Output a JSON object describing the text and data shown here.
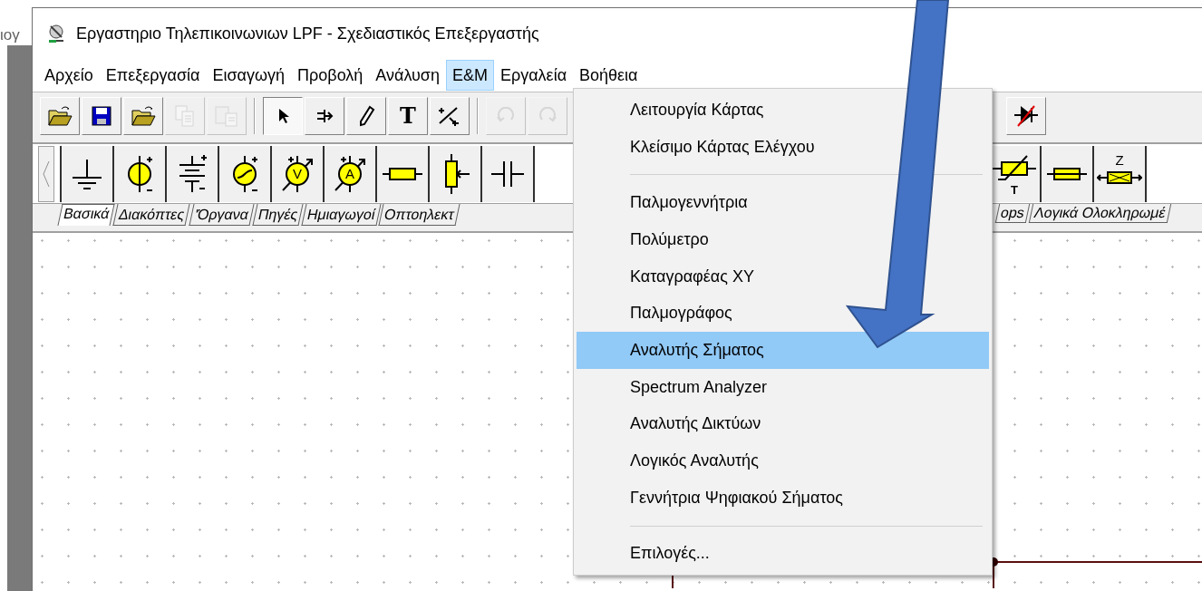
{
  "background_text": "ιογ",
  "window": {
    "title": "Εργαστηριο Τηλεπικοινωνιων LPF - Σχεδιαστικός Επεξεργαστής"
  },
  "menu_bar": [
    {
      "label": "Αρχείο",
      "selected": false
    },
    {
      "label": "Επεξεργασία",
      "selected": false
    },
    {
      "label": "Εισαγωγή",
      "selected": false
    },
    {
      "label": "Προβολή",
      "selected": false
    },
    {
      "label": "Ανάλυση",
      "selected": false
    },
    {
      "label": "E&M",
      "selected": true
    },
    {
      "label": "Εργαλεία",
      "selected": false
    },
    {
      "label": "Βοήθεια",
      "selected": false
    }
  ],
  "toolbar": {
    "left_items": [
      {
        "kind": "open",
        "disabled": false,
        "pressed": false
      },
      {
        "kind": "save",
        "disabled": false,
        "pressed": false
      },
      {
        "kind": "open",
        "disabled": false,
        "pressed": false
      },
      {
        "kind": "copy",
        "disabled": true,
        "pressed": false
      },
      {
        "kind": "paste",
        "disabled": true,
        "pressed": false
      },
      {
        "kind": "separator"
      },
      {
        "kind": "pointer",
        "disabled": false,
        "pressed": true
      },
      {
        "kind": "wire",
        "disabled": false,
        "pressed": false
      },
      {
        "kind": "pencil",
        "disabled": false,
        "pressed": false
      },
      {
        "kind": "text",
        "label": "T",
        "disabled": false,
        "pressed": false
      },
      {
        "kind": "probe",
        "disabled": false,
        "pressed": false
      },
      {
        "kind": "separator"
      },
      {
        "kind": "undo",
        "disabled": true,
        "pressed": false
      },
      {
        "kind": "redo",
        "disabled": true,
        "pressed": false
      }
    ],
    "right_items": [
      {
        "kind": "diode",
        "disabled": false,
        "pressed": false
      }
    ]
  },
  "component_toolbar": {
    "left_items": [
      {
        "kind": "ground"
      },
      {
        "kind": "current-source"
      },
      {
        "kind": "battery"
      },
      {
        "kind": "ac-source"
      },
      {
        "kind": "voltmeter",
        "label": "V"
      },
      {
        "kind": "ammeter",
        "label": "A"
      },
      {
        "kind": "resistor"
      },
      {
        "kind": "potentiometer"
      },
      {
        "kind": "capacitor"
      }
    ],
    "right_items": [
      {
        "kind": "thermistor",
        "label": "T"
      },
      {
        "kind": "fuse"
      },
      {
        "kind": "impedance",
        "label": "Z"
      }
    ]
  },
  "tabs": {
    "left_items": [
      {
        "label": "Βασικά",
        "selected": true
      },
      {
        "label": "Διακόπτες",
        "selected": false
      },
      {
        "label": "'Όργανα",
        "selected": false
      },
      {
        "label": "Πηγές",
        "selected": false
      },
      {
        "label": "Ημιαγωγοί",
        "selected": false
      },
      {
        "label": "Οπτοηλεκτ",
        "selected": false
      }
    ],
    "right_items": [
      {
        "label": "ops",
        "selected": false
      },
      {
        "label": "Λογικά Ολοκληρωμέ",
        "selected": false
      }
    ]
  },
  "dropdown_menu": {
    "items": [
      {
        "kind": "item",
        "label": "Λειτουργία Κάρτας",
        "selected": false
      },
      {
        "kind": "item",
        "label": "Κλείσιμο Κάρτας Ελέγχου",
        "selected": false
      },
      {
        "kind": "separator"
      },
      {
        "kind": "item",
        "label": "Παλμογεννήτρια",
        "selected": false
      },
      {
        "kind": "item",
        "label": "Πολύμετρο",
        "selected": false
      },
      {
        "kind": "item",
        "label": "Καταγραφέας XY",
        "selected": false
      },
      {
        "kind": "item",
        "label": "Παλμογράφος",
        "selected": false
      },
      {
        "kind": "item",
        "label": "Αναλυτής Σήματος",
        "selected": true
      },
      {
        "kind": "item",
        "label": "Spectrum Analyzer",
        "selected": false
      },
      {
        "kind": "item",
        "label": "Αναλυτής Δικτύων",
        "selected": false
      },
      {
        "kind": "item",
        "label": "Λογικός Αναλυτής",
        "selected": false
      },
      {
        "kind": "item",
        "label": "Γεννήτρια Ψηφιακού Σήματος",
        "selected": false
      },
      {
        "kind": "separator"
      },
      {
        "kind": "item",
        "label": "Επιλογές...",
        "selected": false
      }
    ]
  }
}
